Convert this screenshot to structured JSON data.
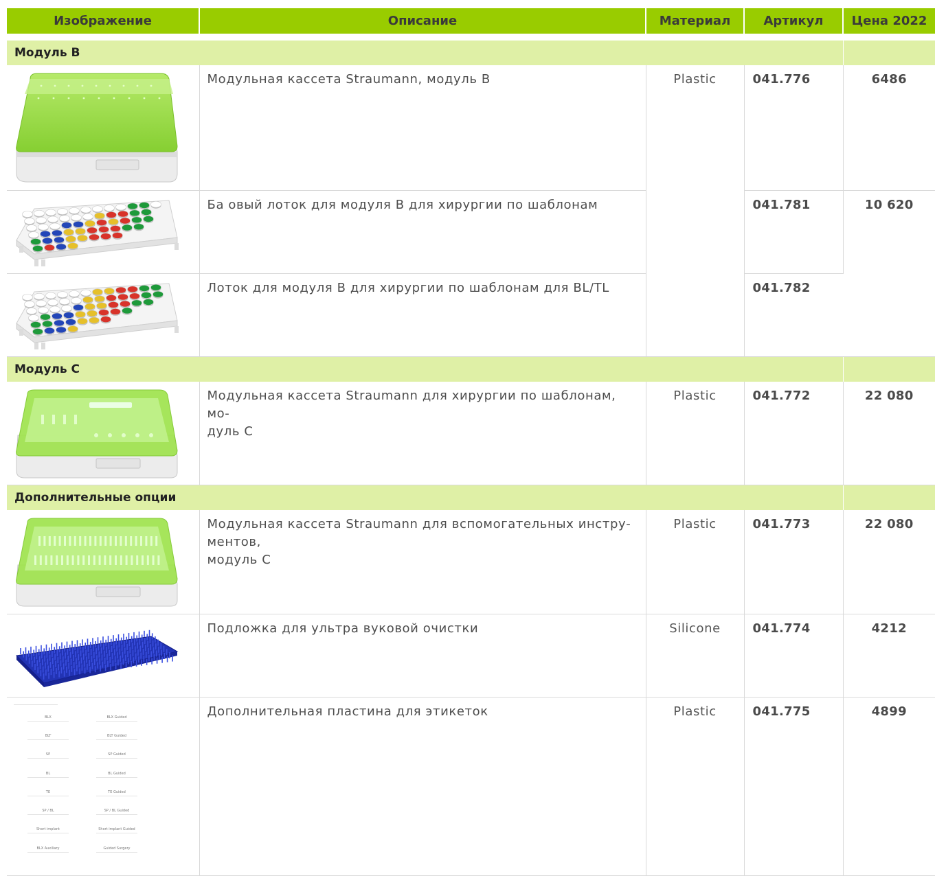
{
  "header": {
    "image": "Изображение",
    "description": "Описание",
    "material": "Материал",
    "article": "Артикул",
    "price": "Цена 2022"
  },
  "sections": [
    {
      "title": "Модуль B",
      "items": [
        {
          "description_lines": [
            "Модульная кассета Straumann, модуль B"
          ],
          "material": "Plastic",
          "article": "041.776",
          "price": "6486",
          "image": "green-cassette-module-b"
        },
        {
          "description_lines": [
            "Ба овый лоток для модуля B для хирургии по шаблонам"
          ],
          "material": "",
          "article": "041.781",
          "price": "10 620",
          "image": "color-tray-basic"
        },
        {
          "description_lines": [
            "Лоток для модуля B для хирургии по шаблонам для BL/TL"
          ],
          "material": "",
          "article": "041.782",
          "price": "",
          "image": "color-tray-bl-tl"
        }
      ]
    },
    {
      "title": "Модуль C",
      "items": [
        {
          "description_lines": [
            "Модульная кассета Straumann для хирургии по шаблонам, мо-",
            "дуль C"
          ],
          "material": "Plastic",
          "article": "041.772",
          "price": "22 080",
          "image": "green-cassette-module-c"
        }
      ]
    },
    {
      "title": "Дополнительные опции",
      "items": [
        {
          "description_lines": [
            "Модульная кассета Straumann для вспомогательных инстру-",
            "ментов,",
            "модуль C"
          ],
          "material": "Plastic",
          "article": "041.773",
          "price": "22 080",
          "image": "green-cassette-aux"
        },
        {
          "description_lines": [
            "Подложка для ультра вуковой очистки"
          ],
          "material": "Silicone",
          "article": "041.774",
          "price": "4212",
          "image": "blue-silicone-mat"
        },
        {
          "description_lines": [
            "Дополнительная пластина для этикеток"
          ],
          "material": "Plastic",
          "article": "041.775",
          "price": "4899",
          "image": "label-plate"
        }
      ]
    }
  ],
  "label_plate": {
    "rows": [
      [
        "BLX",
        "BLX Guided"
      ],
      [
        "BLT",
        "BLT Guided"
      ],
      [
        "SP",
        "SP Guided"
      ],
      [
        "BL",
        "BL Guided"
      ],
      [
        "TE",
        "TE Guided"
      ],
      [
        "SP / BL",
        "SP / BL Guided"
      ],
      [
        "Short implant",
        "Short implant Guided"
      ],
      [
        "BLX Auxiliary",
        "Guided Surgery"
      ]
    ]
  },
  "colors": {
    "header_bg": "#99cc00",
    "section_bg": "#dff0a6",
    "border": "#d9d9d9",
    "lid_green": "#8fdc3c",
    "mat_blue": "#1f2fb8"
  }
}
